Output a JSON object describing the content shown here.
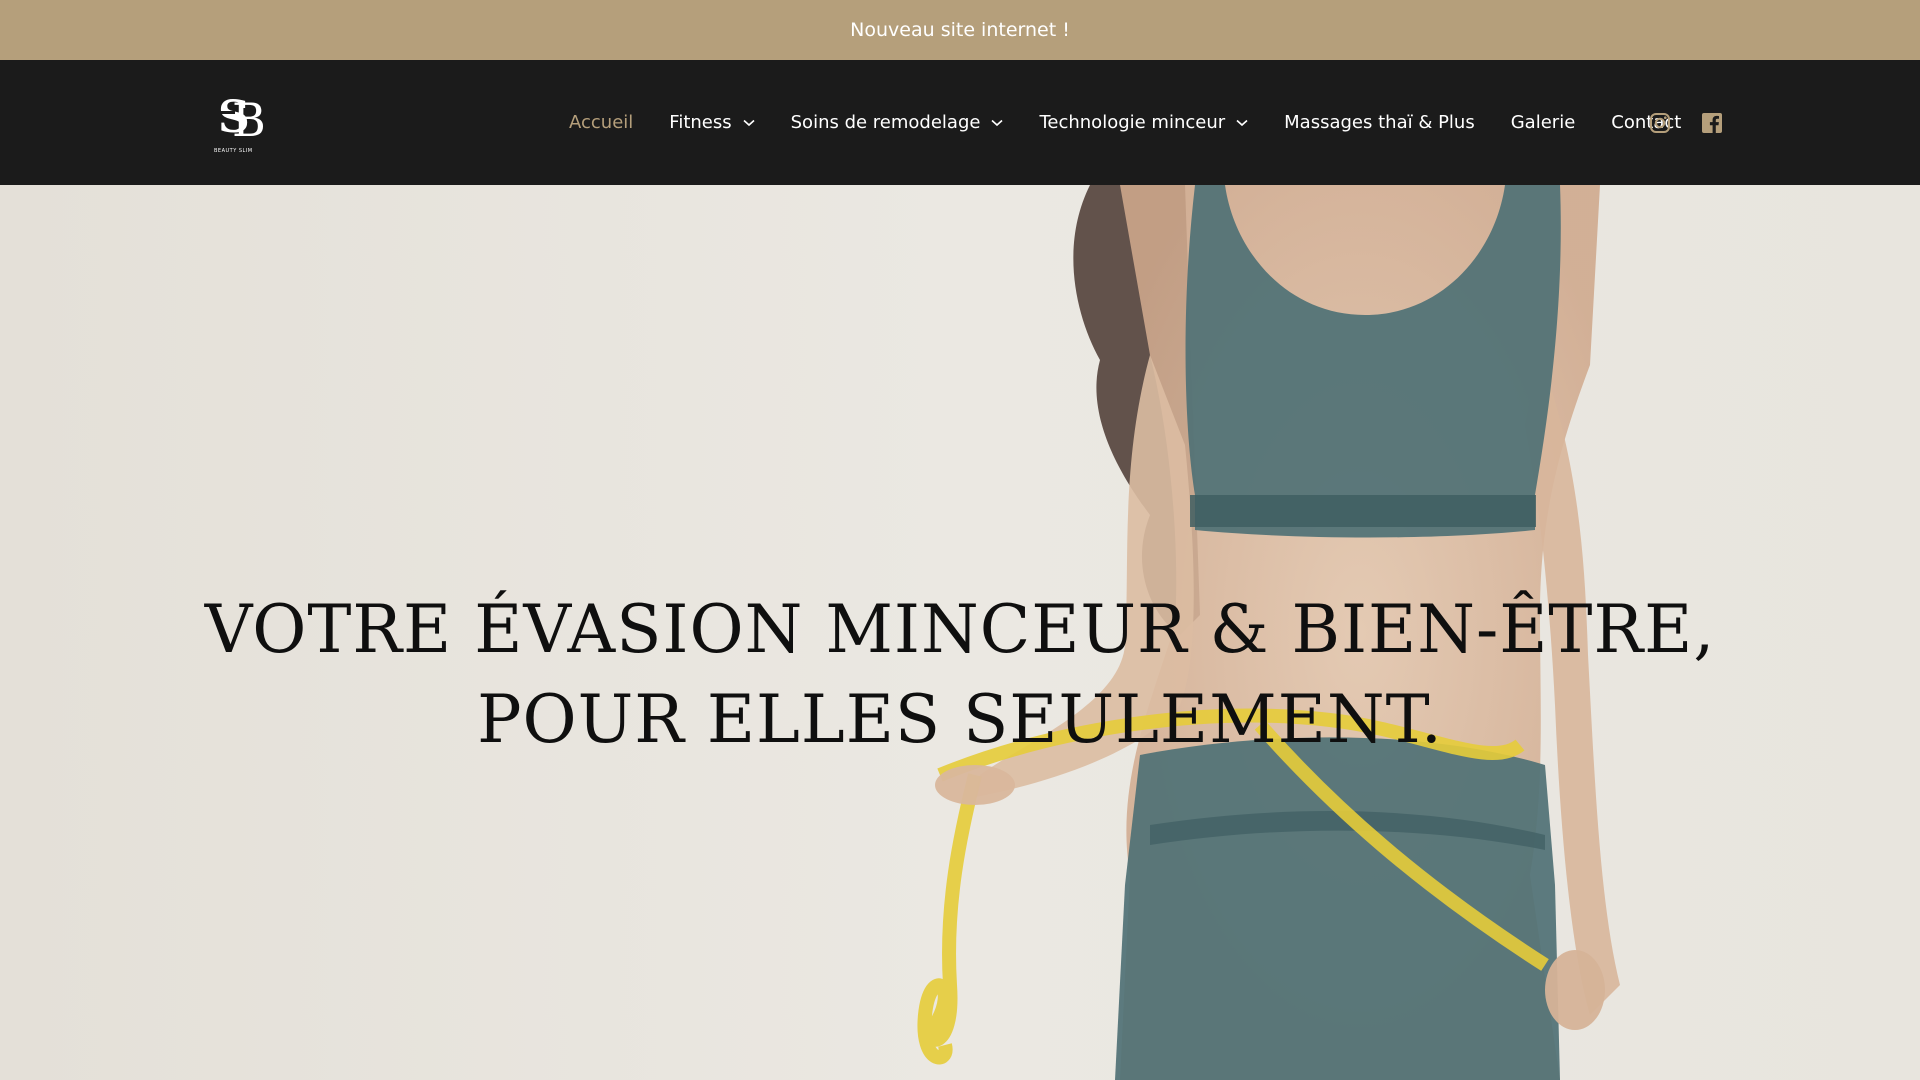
{
  "announcement": {
    "text": "Nouveau site internet !"
  },
  "brand": {
    "monogram": "SB",
    "tagline": "BEAUTY SLIM"
  },
  "nav": {
    "items": [
      {
        "label": "Accueil",
        "active": true,
        "dropdown": false
      },
      {
        "label": "Fitness",
        "active": false,
        "dropdown": true
      },
      {
        "label": "Soins de remodelage",
        "active": false,
        "dropdown": true
      },
      {
        "label": "Technologie minceur",
        "active": false,
        "dropdown": true
      },
      {
        "label": "Massages thaï & Plus",
        "active": false,
        "dropdown": false
      },
      {
        "label": "Galerie",
        "active": false,
        "dropdown": false
      },
      {
        "label": "Contact",
        "active": false,
        "dropdown": false
      }
    ]
  },
  "social": {
    "icons": [
      "instagram-icon",
      "facebook-icon"
    ]
  },
  "hero": {
    "title": "VOTRE ÉVASION MINCEUR & BIEN-ÊTRE, POUR ELLES SEULEMENT."
  },
  "colors": {
    "accent": "#b59f7b",
    "nav_background": "#1b1b1b",
    "hero_background": "#e6e3dc",
    "garment": "#4f7175",
    "tape": "#e6cc3a"
  }
}
